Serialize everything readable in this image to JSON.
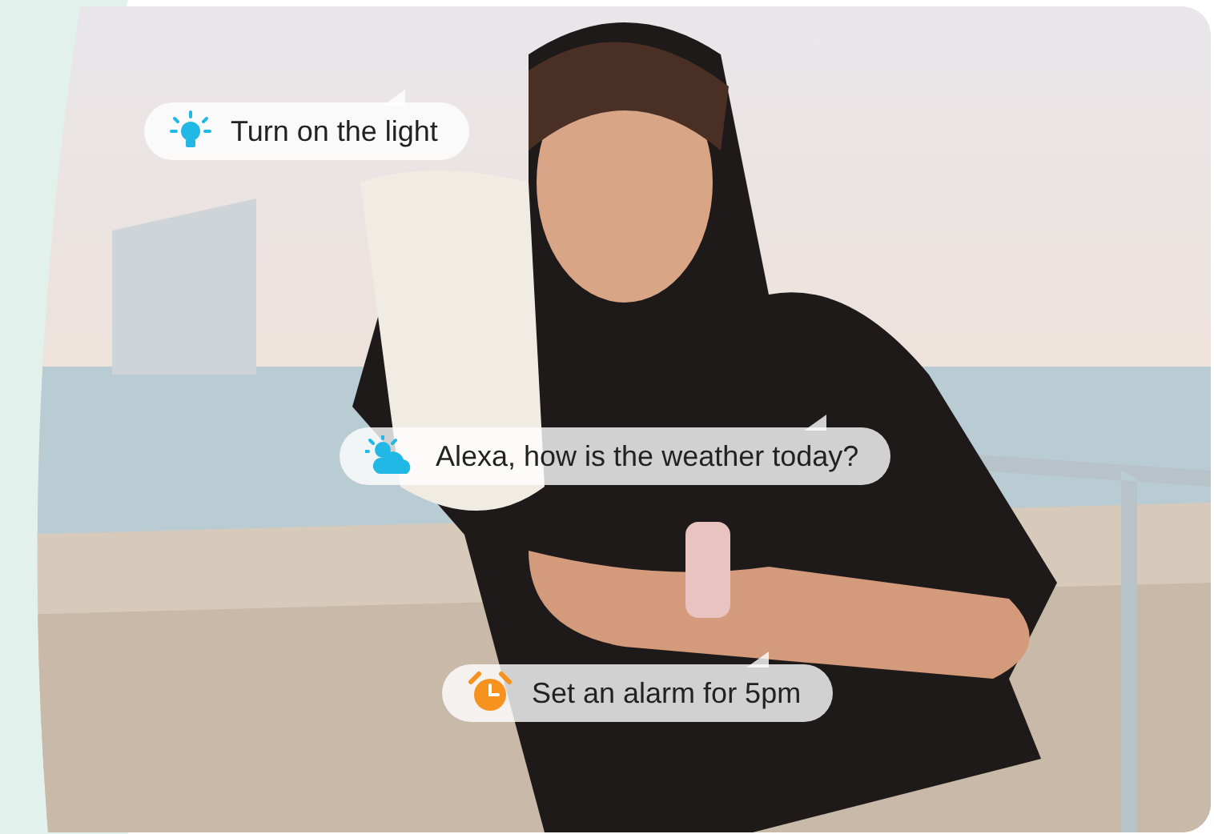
{
  "bubbles": [
    {
      "kind": "light",
      "text": "Turn on the light"
    },
    {
      "kind": "weather",
      "text": "Alexa, how is the weather today?"
    },
    {
      "kind": "alarm",
      "text": "Set an alarm for 5pm"
    }
  ]
}
